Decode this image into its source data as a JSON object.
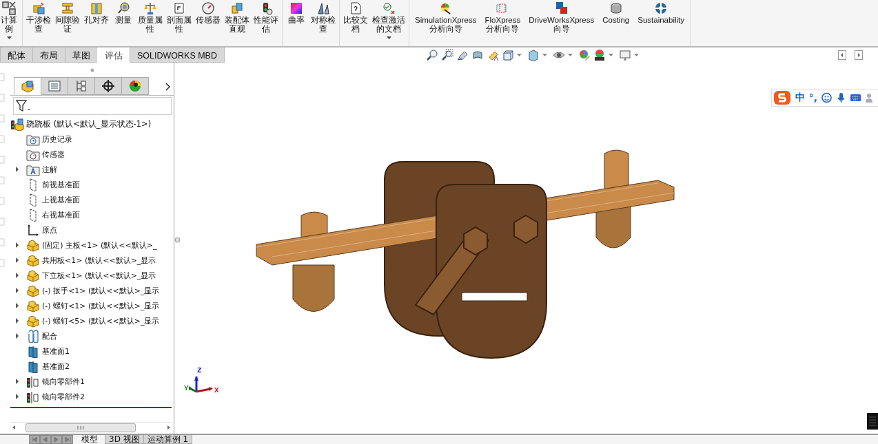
{
  "ribbon": {
    "groups": [
      {
        "buttons": [
          {
            "lines": [
              "计算",
              "例"
            ],
            "dropdown": true,
            "cut": true
          }
        ]
      },
      {
        "buttons": [
          {
            "lines": [
              "干涉检",
              "查"
            ],
            "dropdown": false
          },
          {
            "lines": [
              "间隙验",
              "证"
            ],
            "dropdown": false
          },
          {
            "lines": [
              "孔对齐"
            ],
            "dropdown": false
          },
          {
            "lines": [
              "测量"
            ],
            "dropdown": false
          },
          {
            "lines": [
              "质量属",
              "性"
            ],
            "dropdown": false
          },
          {
            "lines": [
              "剖面属",
              "性"
            ],
            "dropdown": false
          },
          {
            "lines": [
              "传感器"
            ],
            "dropdown": false
          },
          {
            "lines": [
              "装配体",
              "直观"
            ],
            "dropdown": false
          },
          {
            "lines": [
              "性能评",
              "估"
            ],
            "dropdown": false
          }
        ]
      },
      {
        "buttons": [
          {
            "lines": [
              "曲率"
            ],
            "dropdown": false
          },
          {
            "lines": [
              "对称检",
              "查"
            ],
            "dropdown": false
          }
        ]
      },
      {
        "buttons": [
          {
            "lines": [
              "比较文",
              "档"
            ],
            "dropdown": false
          },
          {
            "lines": [
              "检查激活",
              "的文档"
            ],
            "dropdown": true
          }
        ]
      },
      {
        "buttons": [
          {
            "lines": [
              "SimulationXpress",
              "分析向导"
            ],
            "dropdown": false
          },
          {
            "lines": [
              "FloXpress",
              "分析向导"
            ],
            "dropdown": false
          },
          {
            "lines": [
              "DriveWorksXpress",
              "向导"
            ],
            "dropdown": false
          },
          {
            "lines": [
              "Costing"
            ],
            "dropdown": false
          },
          {
            "lines": [
              "Sustainability"
            ],
            "dropdown": false
          }
        ]
      }
    ]
  },
  "command_tabs": [
    {
      "label": "配体",
      "selected": false
    },
    {
      "label": "布局",
      "selected": false
    },
    {
      "label": "草图",
      "selected": false
    },
    {
      "label": "评估",
      "selected": true
    },
    {
      "label": "SOLIDWORKS MBD",
      "selected": false
    }
  ],
  "feature_manager": {
    "tabs": [
      {
        "kind": "features",
        "selected": true
      },
      {
        "kind": "properties",
        "selected": false
      },
      {
        "kind": "configurations",
        "selected": false
      },
      {
        "kind": "dimxpert",
        "selected": false
      },
      {
        "kind": "display",
        "selected": false
      }
    ],
    "tree": {
      "label": "跷跷板  (默认<默认_显示状态-1>)",
      "kind": "assembly",
      "expandable": false,
      "children": [
        {
          "label": "历史记录",
          "kind": "history",
          "expandable": false
        },
        {
          "label": "传感器",
          "kind": "sensors",
          "expandable": false
        },
        {
          "label": "注解",
          "kind": "annotations",
          "expandable": true
        },
        {
          "label": "前视基准面",
          "kind": "plane",
          "expandable": false
        },
        {
          "label": "上视基准面",
          "kind": "plane",
          "expandable": false
        },
        {
          "label": "右视基准面",
          "kind": "plane",
          "expandable": false
        },
        {
          "label": "原点",
          "kind": "origin",
          "expandable": false
        },
        {
          "label": "(固定) 主板<1> (默认<<默认>_",
          "kind": "part",
          "expandable": true
        },
        {
          "label": "共用板<1> (默认<<默认>_显示",
          "kind": "part",
          "expandable": true
        },
        {
          "label": "下立板<1> (默认<<默认>_显示",
          "kind": "part",
          "expandable": true
        },
        {
          "label": "(-) 扳手<1> (默认<<默认>_显示",
          "kind": "part",
          "expandable": true
        },
        {
          "label": "(-) 螺钉<1> (默认<<默认>_显示",
          "kind": "part",
          "expandable": true
        },
        {
          "label": "(-) 螺钉<5> (默认<<默认>_显示",
          "kind": "part",
          "expandable": true
        },
        {
          "label": "配合",
          "kind": "mates",
          "expandable": true
        },
        {
          "label": "基准面1",
          "kind": "refplane",
          "expandable": false
        },
        {
          "label": "基准面2",
          "kind": "refplane",
          "expandable": false
        },
        {
          "label": "镜向零部件1",
          "kind": "mirror",
          "expandable": true
        },
        {
          "label": "镜向零部件2",
          "kind": "mirror",
          "expandable": true
        }
      ]
    }
  },
  "ime_bar": {
    "texts": [
      "中",
      "°,"
    ]
  },
  "triad": {
    "axes": [
      {
        "label": "Z"
      },
      {
        "label": "Y"
      },
      {
        "label": "X"
      }
    ]
  },
  "bottom_tabs": [
    {
      "label": "模型",
      "selected": true
    },
    {
      "label": "3D 视图",
      "selected": false
    },
    {
      "label": "运动算例 1",
      "selected": false
    }
  ]
}
